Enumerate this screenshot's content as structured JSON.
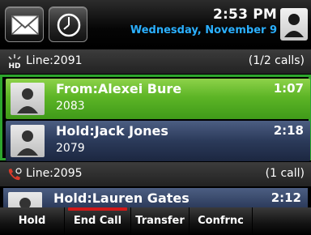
{
  "status": {
    "time": "2:53 PM",
    "date": "Wednesday, November 9"
  },
  "icons": {
    "messages": "envelope-icon",
    "recent": "clock-icon",
    "user": "user-avatar-icon",
    "hd": "hd-audio-icon",
    "line2": "phone-handset-icon"
  },
  "lines": [
    {
      "label": "Line:2091",
      "count": "(1/2 calls)",
      "calls": [
        {
          "name": "From:Alexei Bure",
          "number": "2083",
          "timer": "1:07",
          "state": "active"
        },
        {
          "name": "Hold:Jack Jones",
          "number": "2079",
          "timer": "2:18",
          "state": "hold"
        }
      ]
    },
    {
      "label": "Line:2095",
      "count": "(1 call)",
      "calls": [
        {
          "name": "Hold:Lauren Gates",
          "timer": "2:12",
          "state": "hold"
        }
      ]
    }
  ],
  "softkeys": [
    {
      "label": "Hold",
      "highlight": false
    },
    {
      "label": "End Call",
      "highlight": true
    },
    {
      "label": "Transfer",
      "highlight": false
    },
    {
      "label": "Confrnc",
      "highlight": false
    }
  ],
  "colors": {
    "active_call": "#5db526",
    "hold_call": "#2b3a5a",
    "frame": "#2da52d",
    "date": "#2bb0ff",
    "end_call_bar": "#d01818"
  }
}
